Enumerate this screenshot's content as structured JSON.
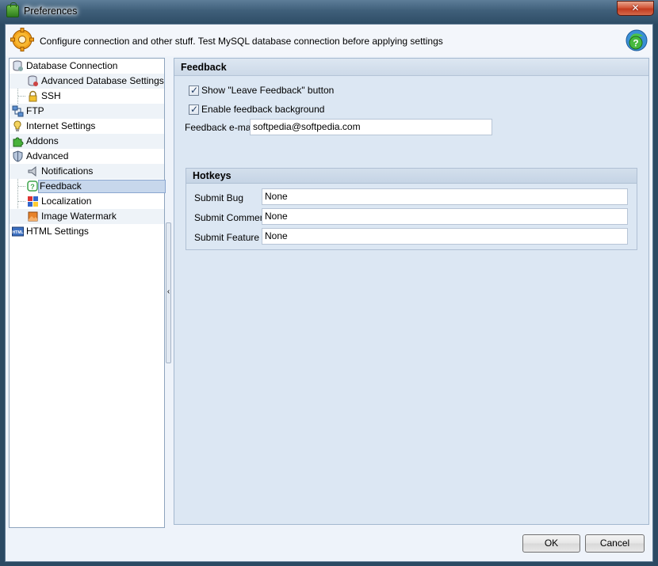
{
  "window": {
    "title": "Preferences",
    "close_label": "✕"
  },
  "header": {
    "text": "Configure connection and other stuff. Test MySQL database connection before applying settings"
  },
  "tree": {
    "items": [
      {
        "label": "Database Connection",
        "icon": "database-icon",
        "level": 0
      },
      {
        "label": "Advanced Database Settings",
        "icon": "database-settings-icon",
        "level": 1
      },
      {
        "label": "SSH",
        "icon": "lock-icon",
        "level": 1
      },
      {
        "label": "FTP",
        "icon": "ftp-network-icon",
        "level": 0
      },
      {
        "label": "Internet Settings",
        "icon": "internet-settings-icon",
        "level": 0
      },
      {
        "label": "Addons",
        "icon": "puzzle-icon",
        "level": 0
      },
      {
        "label": "Advanced",
        "icon": "shield-icon",
        "level": 0
      },
      {
        "label": "Notifications",
        "icon": "notifications-icon",
        "level": 1
      },
      {
        "label": "Feedback",
        "icon": "feedback-icon",
        "level": 1,
        "selected": true
      },
      {
        "label": "Localization",
        "icon": "localization-flag-icon",
        "level": 1
      },
      {
        "label": "Image Watermark",
        "icon": "image-watermark-icon",
        "level": 1
      },
      {
        "label": "HTML Settings",
        "icon": "html-icon",
        "level": 0
      }
    ]
  },
  "feedback": {
    "section_title": "Feedback",
    "show_button_label": "Show \"Leave Feedback\" button",
    "show_button_checked": true,
    "enable_background_label": "Enable feedback background",
    "enable_background_checked": true,
    "email_label": "Feedback e-mail",
    "email_value": "softpedia@softpedia.com"
  },
  "hotkeys": {
    "title": "Hotkeys",
    "rows": [
      {
        "label": "Submit Bug",
        "value": "None"
      },
      {
        "label": "Submit Comment",
        "value": "None"
      },
      {
        "label": "Submit Feature",
        "value": "None"
      }
    ]
  },
  "buttons": {
    "ok": "OK",
    "cancel": "Cancel"
  }
}
